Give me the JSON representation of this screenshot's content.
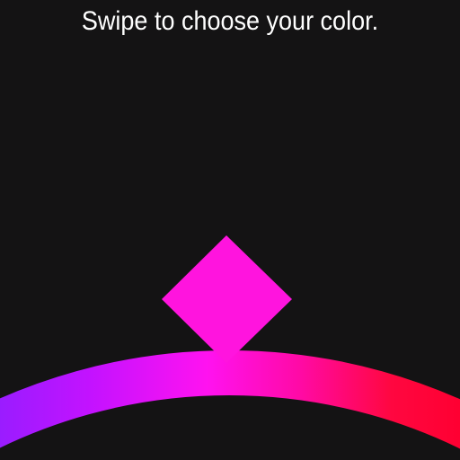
{
  "header": {
    "instruction": "Swipe to choose your color."
  },
  "colors": {
    "background": "#141314",
    "text": "#ffffff",
    "selected": "#ff14de",
    "wheel_gradient": [
      "#9a1cff",
      "#c412ff",
      "#ff12f0",
      "#ff0aa6",
      "#ff0740",
      "#ff0032"
    ]
  },
  "picker": {
    "indicator_icon": "diamond-icon",
    "selected_color": "#ff14de"
  }
}
